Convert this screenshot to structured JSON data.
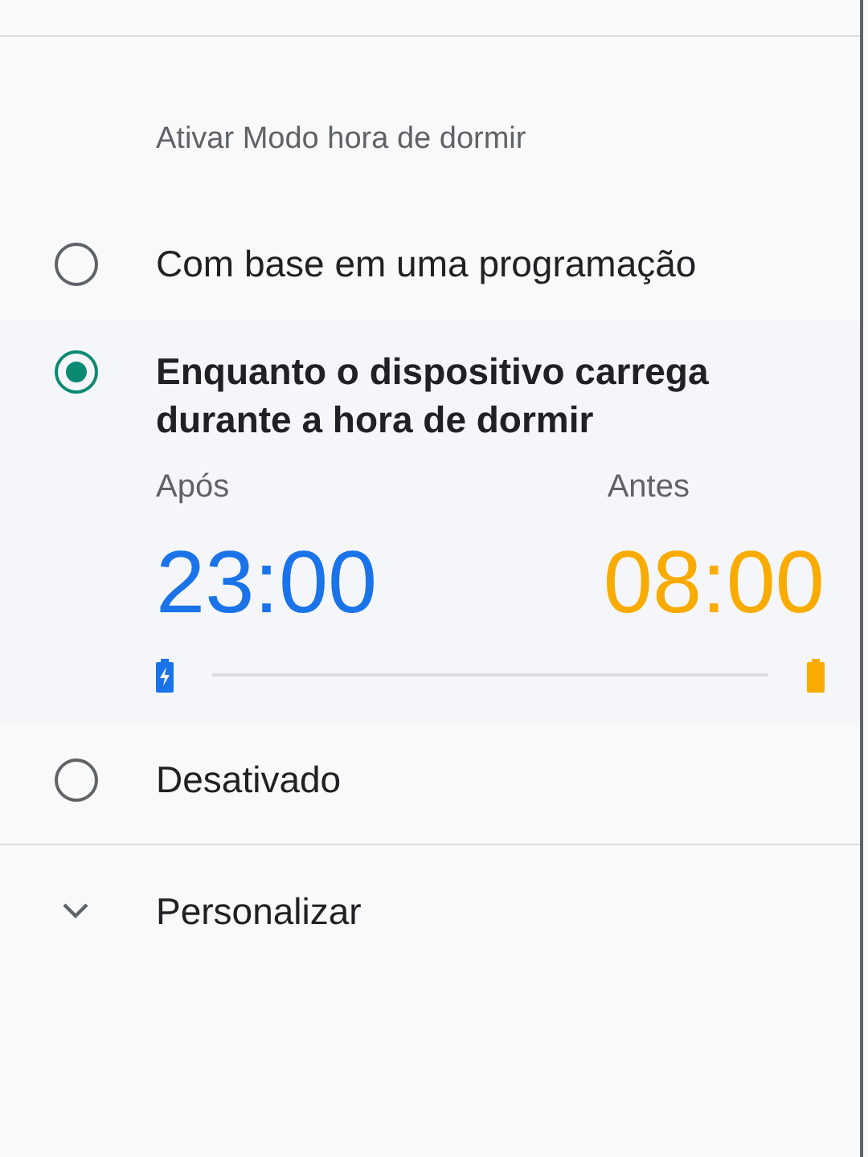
{
  "section_title": "Ativar Modo hora de dormir",
  "options": [
    {
      "label": "Com base em uma programação",
      "selected": false
    },
    {
      "label": "Enquanto o dispositivo carrega durante a hora de dormir",
      "selected": true,
      "schedule": {
        "start_label": "Após",
        "start_time": "23:00",
        "end_label": "Antes",
        "end_time": "08:00"
      }
    },
    {
      "label": "Desativado",
      "selected": false
    }
  ],
  "expander": {
    "label": "Personalizar",
    "expanded": false
  }
}
